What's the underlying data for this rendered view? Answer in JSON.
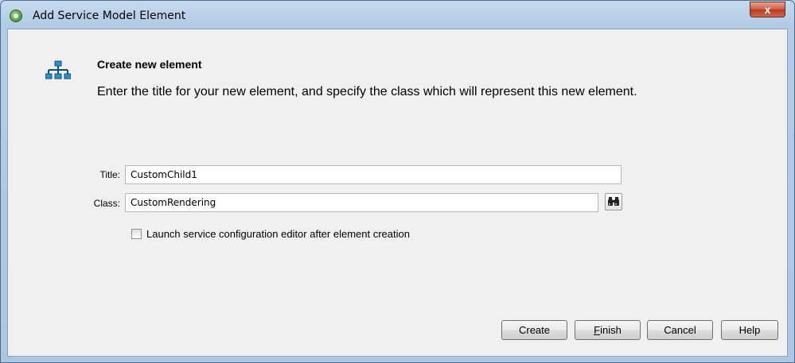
{
  "window": {
    "title": "Add Service Model Element",
    "close_glyph": "x"
  },
  "header": {
    "title": "Create new element",
    "description": "Enter the title for your new element, and specify the class which will represent this new element.",
    "icon": "hierarchy-icon"
  },
  "form": {
    "title_label": "Title:",
    "title_value": "CustomChild1",
    "class_label": "Class:",
    "class_value": "CustomRendering",
    "browse_icon": "binoculars-icon",
    "launch_editor_label": "Launch service configuration editor after element creation",
    "launch_editor_checked": false
  },
  "buttons": {
    "create": "Create",
    "finish_mnemonic": "F",
    "finish_rest": "inish",
    "cancel": "Cancel",
    "help": "Help"
  }
}
